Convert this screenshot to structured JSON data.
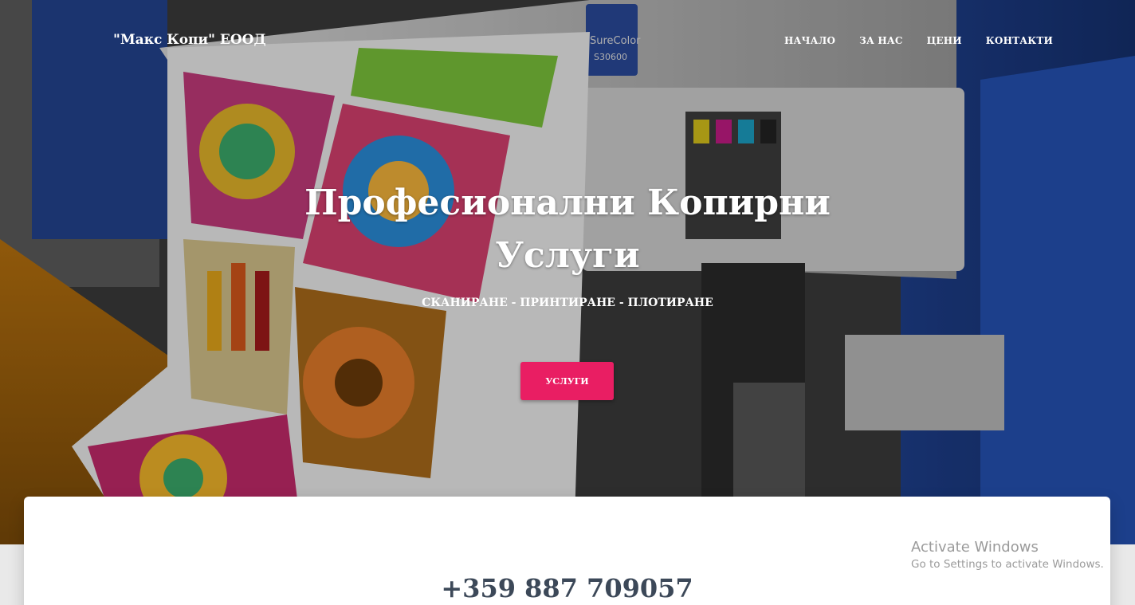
{
  "header": {
    "brand": "\"Макс Копи\" ЕООД",
    "nav": [
      {
        "label": "НАЧАЛО"
      },
      {
        "label": "ЗА НАС"
      },
      {
        "label": "ЦЕНИ"
      },
      {
        "label": "КОНТАКТИ"
      }
    ]
  },
  "hero": {
    "title_line1": "Професионални Копирни",
    "title_line2": "Услуги",
    "subtitle": "СКАНИРАНЕ - ПРИНТИРАНЕ - ПЛОТИРАНЕ",
    "cta_label": "УСЛУГИ",
    "printer_brand": "SureColor",
    "printer_model": "S30600"
  },
  "content": {
    "phone": "+359 887 709057"
  },
  "watermark": {
    "title": "Activate Windows",
    "subtitle": "Go to Settings to activate Windows."
  },
  "colors": {
    "accent": "#e91e63",
    "heading_text": "#3c4858",
    "card_bg": "#ffffff"
  }
}
